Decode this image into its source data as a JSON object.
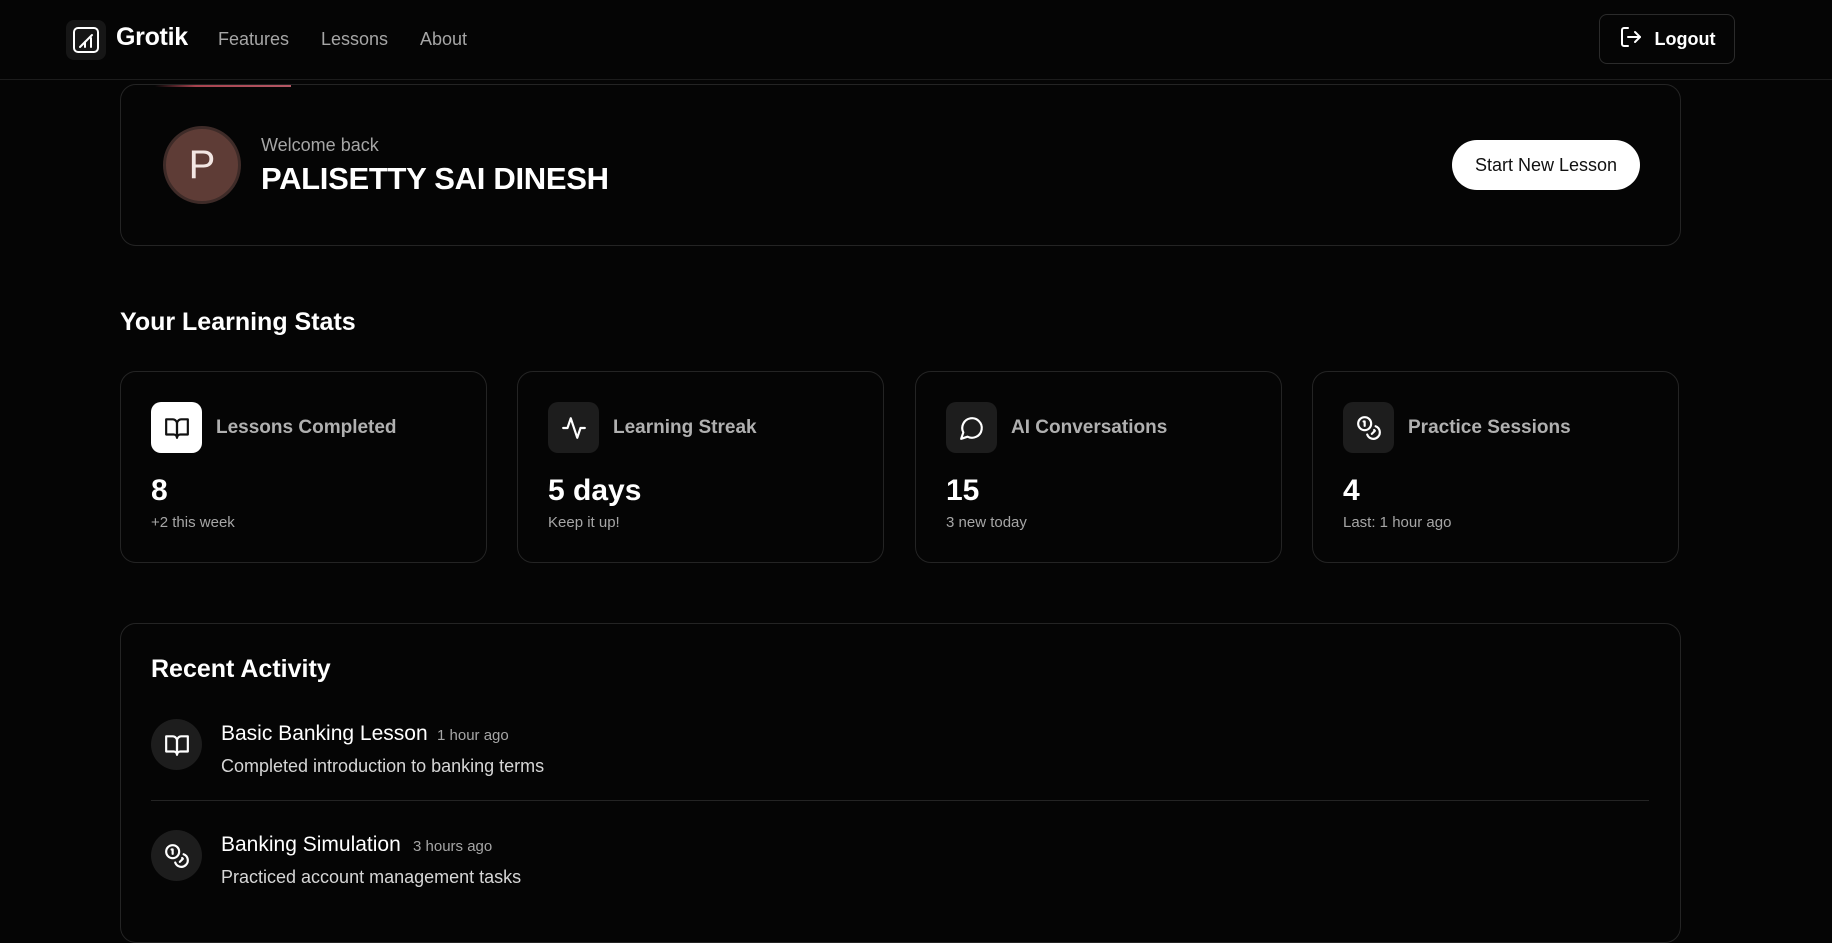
{
  "header": {
    "brand": "Grotik",
    "nav": [
      "Features",
      "Lessons",
      "About"
    ],
    "logout_label": "Logout"
  },
  "welcome": {
    "avatar_initial": "P",
    "greeting": "Welcome back",
    "user_name": "PALISETTY SAI DINESH",
    "start_label": "Start New Lesson"
  },
  "stats": {
    "title": "Your Learning Stats",
    "cards": [
      {
        "icon": "book-open-icon",
        "label": "Lessons Completed",
        "value": "8",
        "sub": "+2 this week"
      },
      {
        "icon": "activity-icon",
        "label": "Learning Streak",
        "value": "5 days",
        "sub": "Keep it up!"
      },
      {
        "icon": "message-circle-icon",
        "label": "AI Conversations",
        "value": "15",
        "sub": "3 new today"
      },
      {
        "icon": "coins-icon",
        "label": "Practice Sessions",
        "value": "4",
        "sub": "Last: 1 hour ago"
      }
    ]
  },
  "activity": {
    "title": "Recent Activity",
    "items": [
      {
        "icon": "book-open-icon",
        "title": "Basic Banking Lesson",
        "time": "1 hour ago",
        "desc": "Completed introduction to banking terms"
      },
      {
        "icon": "coins-icon",
        "title": "Banking Simulation",
        "time": "3 hours ago",
        "desc": "Practiced account management tasks"
      }
    ]
  },
  "colors": {
    "background": "#050505",
    "card_border": "#242424",
    "muted_text": "#a6a6a6",
    "accent": "#a8434f",
    "avatar": "#5e3c36"
  }
}
